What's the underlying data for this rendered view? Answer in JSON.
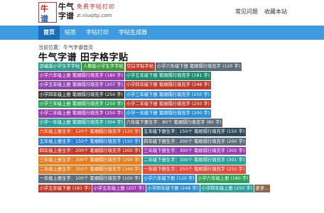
{
  "site": {
    "name_line1": "牛气",
    "name_line2": "字谱",
    "slogan": "免费字帖打印",
    "url": "zi.niuqitp.com"
  },
  "logo": {
    "char_top": "牛",
    "char_bottom": "谱"
  },
  "top_links": [
    "常见问题",
    "收藏本站"
  ],
  "nav": [
    "首页",
    "帖签",
    "字帖打印",
    "字帖生成器"
  ],
  "breadcrumb": "当前位置：牛气字谱首页",
  "page_title": "牛气字谱 田字格字贴",
  "tags": [
    {
      "text": "部编版小学生字字帖",
      "color": "#2a9a8a"
    },
    {
      "text": "人教版小学生字字帖",
      "color": "#3a9a3a"
    },
    {
      "text": "空白字贴字帖",
      "color": "#c0392b"
    },
    {
      "text": "小学六年级下册 笔顺隔行填充字 ",
      "count": "(120 字)",
      "color": "#5a6b7a"
    },
    {
      "text": "小学六年级上册 笔顺隔行填充字 ",
      "count": "(180 字)",
      "color": "#9b3bb0"
    },
    {
      "text": "小学五年级下册 笔顺隔行填充字 ",
      "count": "(181 字)",
      "color": "#1e8c6e"
    },
    {
      "text": "小学五年级上册 笔顺隔行填充字 ",
      "count": "(207 字)",
      "color": "#8e44ad"
    },
    {
      "text": "小学四年级下册 笔顺隔行填充字 ",
      "count": "(248 字)",
      "color": "#c0392b"
    },
    {
      "text": "小学四年级上册 笔顺隔行填充字 ",
      "count": "(250 字)",
      "color": "#3d3d3d"
    },
    {
      "text": "小学三年级下册 笔顺隔行填充字 ",
      "count": "(250 字)",
      "color": "#2a8fd6"
    },
    {
      "text": "小学三年级上册 笔顺隔行填充字 ",
      "count": "(250 字)",
      "color": "#2ea05a"
    },
    {
      "text": "小学二年级下册 笔顺隔行填充字 ",
      "count": "(250 字)",
      "color": "#c0392b"
    },
    {
      "text": "小学二年级上册 笔顺隔行填充字 ",
      "count": "(250 字)",
      "color": "#9b3bb0"
    },
    {
      "text": "小学一年级下册 笔顺隔行填充字 ",
      "count": "(200 字)",
      "color": "#2a8fd6"
    },
    {
      "text": "小学一年级上册 笔顺隔行填充字 ",
      "count": "(304 字)",
      "color": "#2aa09a"
    },
    {
      "text": "六年级下册生字：80个 笔顺隔行填充字 ",
      "count": "(80 字)",
      "color": "#5a6b7a"
    },
    {
      "text": "六年级上册生字：120个 笔顺隔行填充字 ",
      "count": "(120 字)",
      "color": "#e74c1c"
    },
    {
      "text": "五年级下册生字：150个 笔顺隔行填充字 ",
      "count": "(150 字)",
      "color": "#2e4a5a"
    },
    {
      "text": "五年级上册生字：150个 笔顺隔行填充字 ",
      "count": "(150 字)",
      "color": "#2a7fd0"
    },
    {
      "text": "四年级下册生字：200个 笔顺隔行填充字 ",
      "count": "(200 字)",
      "color": "#5a6b7a"
    },
    {
      "text": "四年级上册生字：200个 笔顺隔行填充字 ",
      "count": "(200 字)",
      "color": "#c0392b"
    },
    {
      "text": "三年级下册生字：300个 笔顺隔行填充字 ",
      "count": "(300 字)",
      "color": "#9b3bb0"
    },
    {
      "text": "三年级上册生字：300个 笔顺隔行填充字 ",
      "count": "(299 字)",
      "color": "#e67e22"
    },
    {
      "text": "二年级下册生字：300个 笔顺隔行填充字 ",
      "count": "(301 字)",
      "color": "#2aa09a"
    },
    {
      "text": "二年级上册生字：350个 笔顺隔行填充字 ",
      "count": "(349 字)",
      "color": "#e67e22"
    },
    {
      "text": "一年级下册生字：250个 笔顺隔行填充字 ",
      "count": "(250 字)",
      "color": "#e74c3c"
    },
    {
      "text": "一年级上册生字：100个 笔顺隔行填充字 ",
      "count": "(100 字)",
      "color": "#5a6b7a"
    },
    {
      "text": "小学六年级下册 ",
      "count": "(120 字)",
      "color": "#2a8fd6"
    },
    {
      "text": "小学六年级上册 ",
      "count": "(180 字)",
      "color": "#2ea05a"
    },
    {
      "text": "小学五年级下册 ",
      "count": "(181 字)",
      "color": "#c0392b"
    },
    {
      "text": "小学五年级上册 ",
      "count": "(207 字)",
      "color": "#9b3bb0"
    },
    {
      "text": "小学四年级下册 ",
      "count": "(248 字)",
      "color": "#2a8fd6"
    },
    {
      "text": "小学四年级上册 ",
      "count": "(250 字)",
      "color": "#2aa09a"
    },
    {
      "text": "更多...",
      "color": "#8a6a4a"
    }
  ]
}
